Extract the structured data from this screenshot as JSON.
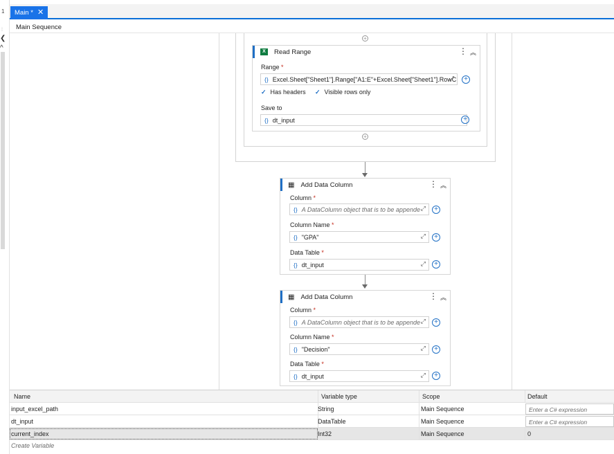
{
  "left_gutter": {
    "number": "1",
    "chevron_left": "❮",
    "chevron_up": "^"
  },
  "tabs": [
    {
      "label": "Main *",
      "close": "✕"
    }
  ],
  "breadcrumb": "Main Sequence",
  "read_range": {
    "title": "Read Range",
    "range_label": "Range",
    "range_value": "Excel.Sheet[\"Sheet1\"].Range[\"A1:E\"+Excel.Sheet[\"Sheet1\"].RowC",
    "has_headers": "Has headers",
    "visible_rows_only": "Visible rows only",
    "save_to_label": "Save to",
    "save_to_value": "dt_input"
  },
  "add_column_1": {
    "title": "Add Data Column",
    "column_label": "Column",
    "column_placeholder": "A DataColumn object that is to be appende",
    "column_name_label": "Column Name",
    "column_name_value": "\"GPA\"",
    "data_table_label": "Data Table",
    "data_table_value": "dt_input"
  },
  "add_column_2": {
    "title": "Add Data Column",
    "column_label": "Column",
    "column_placeholder": "A DataColumn object that is to be appende",
    "column_name_label": "Column Name",
    "column_name_value": "\"Decision\"",
    "data_table_label": "Data Table",
    "data_table_value": "dt_input"
  },
  "variables": {
    "headers": [
      "Name",
      "Variable type",
      "Scope",
      "Default"
    ],
    "rows": [
      {
        "name": "input_excel_path",
        "type": "String",
        "scope": "Main Sequence",
        "default": "Enter a C# expression"
      },
      {
        "name": "dt_input",
        "type": "DataTable",
        "scope": "Main Sequence",
        "default": "Enter a C# expression"
      },
      {
        "name": "current_index",
        "type": "Int32",
        "scope": "Main Sequence",
        "default": "0"
      }
    ],
    "create_variable": "Create Variable"
  },
  "glyphs": {
    "brace": "{}",
    "plus": "+",
    "expand": "⤢",
    "menu": "⋮",
    "collapse": "︽",
    "check": "✓"
  },
  "colors": {
    "accent": "#1a73e8",
    "required": "#c42b1c",
    "excel_green": "#107c41"
  }
}
